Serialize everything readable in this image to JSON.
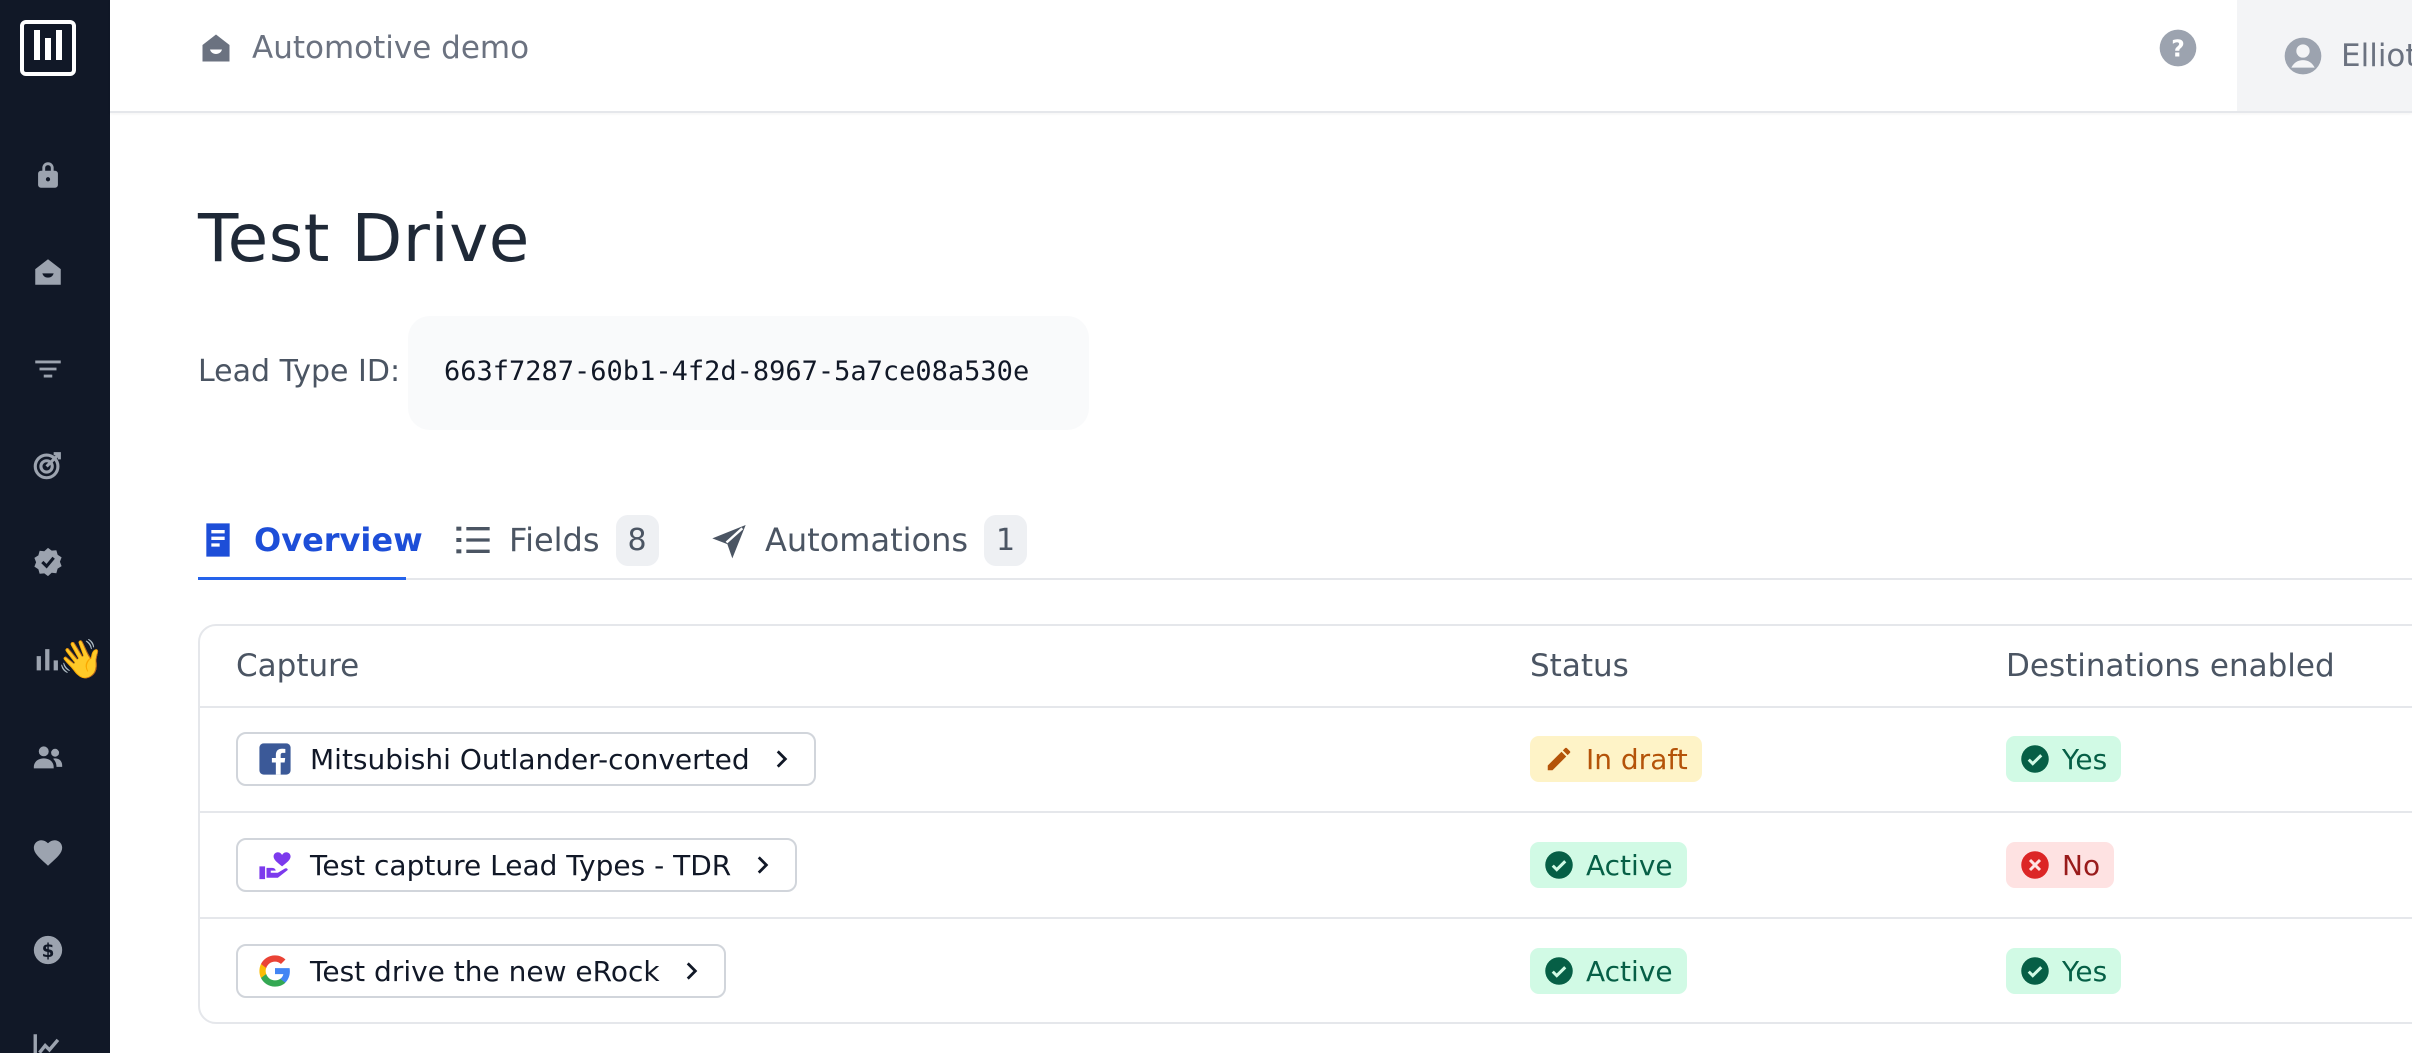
{
  "header": {
    "breadcrumb": "Automotive demo",
    "user_name": "Elliot"
  },
  "sidebar": {
    "icons": [
      "lock-icon",
      "home-icon",
      "filter-icon",
      "target-icon",
      "verified-badge-icon",
      "analytics-icon",
      "users-icon",
      "heart-icon",
      "dollar-icon",
      "chart-line-icon"
    ],
    "emoji": "👋"
  },
  "page": {
    "title": "Test Drive",
    "lead_type_label": "Lead Type ID:",
    "lead_type_id": "663f7287-60b1-4f2d-8967-5a7ce08a530e"
  },
  "tabs": [
    {
      "label": "Overview",
      "active": true
    },
    {
      "label": "Fields",
      "count": "8"
    },
    {
      "label": "Automations",
      "count": "1"
    }
  ],
  "table": {
    "headers": [
      "Capture",
      "Status",
      "Destinations enabled"
    ],
    "rows": [
      {
        "capture": "Mitsubishi Outlander-converted",
        "source_icon": "facebook-icon",
        "status": "In draft",
        "destinations": "Yes"
      },
      {
        "capture": "Test capture Lead Types - TDR",
        "source_icon": "hand-heart-icon",
        "status": "Active",
        "destinations": "No"
      },
      {
        "capture": "Test drive the new eRock",
        "source_icon": "google-icon",
        "status": "Active",
        "destinations": "Yes"
      }
    ]
  },
  "colors": {
    "sidebar_bg": "#111827",
    "accent": "#2563eb",
    "draft": "#b45309",
    "success": "#065f46",
    "danger": "#991b1b"
  }
}
